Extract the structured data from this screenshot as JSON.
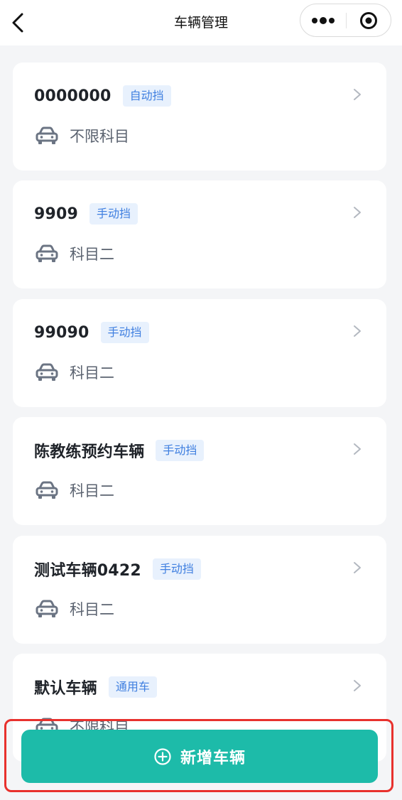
{
  "nav": {
    "title": "车辆管理",
    "back_icon": "chevron-left-icon",
    "more_icon": "more-dots-icon",
    "close_icon": "target-close-icon"
  },
  "vehicles": [
    {
      "name": "0000000",
      "transmission": "自动挡",
      "subject": "不限科目"
    },
    {
      "name": "9909",
      "transmission": "手动挡",
      "subject": "科目二"
    },
    {
      "name": "99090",
      "transmission": "手动挡",
      "subject": "科目二"
    },
    {
      "name": "陈教练预约车辆",
      "transmission": "手动挡",
      "subject": "科目二"
    },
    {
      "name": "测试车辆0422",
      "transmission": "手动挡",
      "subject": "科目二"
    },
    {
      "name": "默认车辆",
      "transmission": "通用车",
      "subject": "不限科目"
    }
  ],
  "add_button": {
    "label": "新增车辆",
    "icon": "plus-circle-icon"
  },
  "colors": {
    "accent": "#1dbba9",
    "tag_bg": "#e8f1fd",
    "tag_text": "#3f7fe0",
    "highlight_border": "#e8312d"
  }
}
